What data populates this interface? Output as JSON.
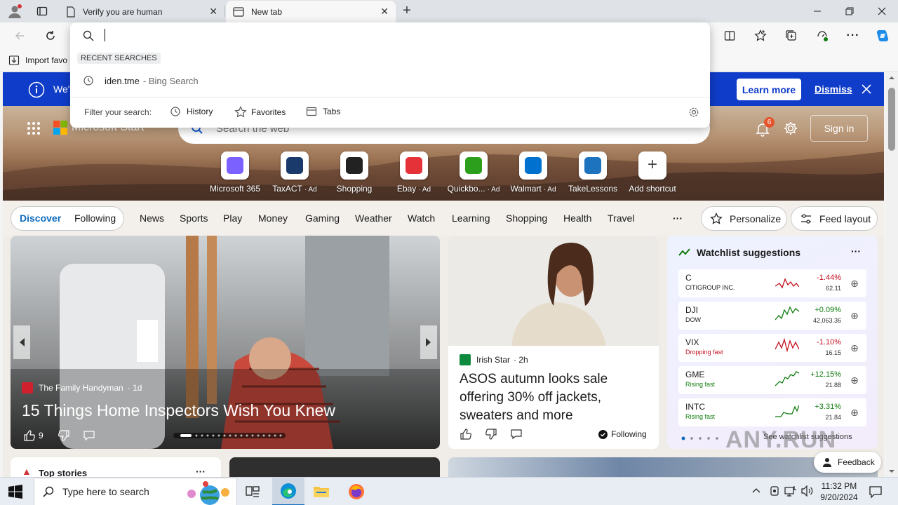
{
  "browser": {
    "tabs": [
      {
        "title": "Verify you are human",
        "active": false
      },
      {
        "title": "New tab",
        "active": true
      }
    ],
    "favorites_bar": {
      "import_label": "Import favo"
    }
  },
  "omnibox": {
    "value": "",
    "recent_heading": "RECENT SEARCHES",
    "recent": [
      {
        "query": "iden.tme",
        "source": "- Bing Search"
      }
    ],
    "filter_label": "Filter your search:",
    "filters": [
      "History",
      "Favorites",
      "Tabs"
    ]
  },
  "infobar": {
    "text": "We'",
    "learn_more": "Learn more",
    "dismiss": "Dismiss"
  },
  "header": {
    "brand": "Microsoft Start",
    "search_placeholder": "Search the web",
    "notification_count": "6",
    "sign_in": "Sign in"
  },
  "shortcuts": [
    {
      "label": "Microsoft 365",
      "ad": "",
      "color": "#7b61ff"
    },
    {
      "label": "TaxACT",
      "ad": "· Ad",
      "color": "#1a3a6b"
    },
    {
      "label": "Shopping",
      "ad": "",
      "color": "#222222"
    },
    {
      "label": "Ebay",
      "ad": "· Ad",
      "color": "#e53238"
    },
    {
      "label": "Quickbo...",
      "ad": "· Ad",
      "color": "#2ca01c"
    },
    {
      "label": "Walmart",
      "ad": "· Ad",
      "color": "#0071ce"
    },
    {
      "label": "TakeLessons",
      "ad": "",
      "color": "#1e73be"
    },
    {
      "label": "Add shortcut",
      "ad": "",
      "color": "#444444"
    }
  ],
  "feed_nav": {
    "discover": "Discover",
    "following": "Following",
    "items": [
      "News",
      "Sports",
      "Play",
      "Money",
      "Gaming",
      "Weather",
      "Watch",
      "Learning",
      "Shopping",
      "Health",
      "Travel"
    ],
    "more": "···",
    "personalize": "Personalize",
    "feed_layout": "Feed layout"
  },
  "hero_story": {
    "source": "The Family Handyman",
    "age": "· 1d",
    "title": "15 Things Home Inspectors Wish You Knew",
    "likes": "9"
  },
  "side_story": {
    "source": "Irish Star",
    "age": "· 2h",
    "title": "ASOS autumn looks sale offering 30% off jackets, sweaters and more",
    "following": "Following"
  },
  "watchlist": {
    "title": "Watchlist suggestions",
    "more": "···",
    "see_more": "See watchlist suggestions",
    "stocks": [
      {
        "symbol": "C",
        "sub": "CITIGROUP INC.",
        "change": "-1.44%",
        "price": "62.11",
        "up": false
      },
      {
        "symbol": "DJI",
        "sub": "DOW",
        "change": "+0.09%",
        "price": "42,063.36",
        "up": true
      },
      {
        "symbol": "VIX",
        "sub": "Dropping fast",
        "change": "-1.10%",
        "price": "16.15",
        "up": false
      },
      {
        "symbol": "GME",
        "sub": "Rising fast",
        "change": "+12.15%",
        "price": "21.88",
        "up": true
      },
      {
        "symbol": "INTC",
        "sub": "Rising fast",
        "change": "+3.31%",
        "price": "21.84",
        "up": true
      }
    ]
  },
  "bottom": {
    "top_stories": "Top stories",
    "feedback": "Feedback"
  },
  "watermark": "ANY.RUN",
  "taskbar": {
    "search_placeholder": "Type here to search",
    "time": "11:32 PM",
    "date": "9/20/2024"
  },
  "colors": {
    "accent": "#0f3cc9",
    "up": "#107c10",
    "down": "#c50f1f"
  }
}
